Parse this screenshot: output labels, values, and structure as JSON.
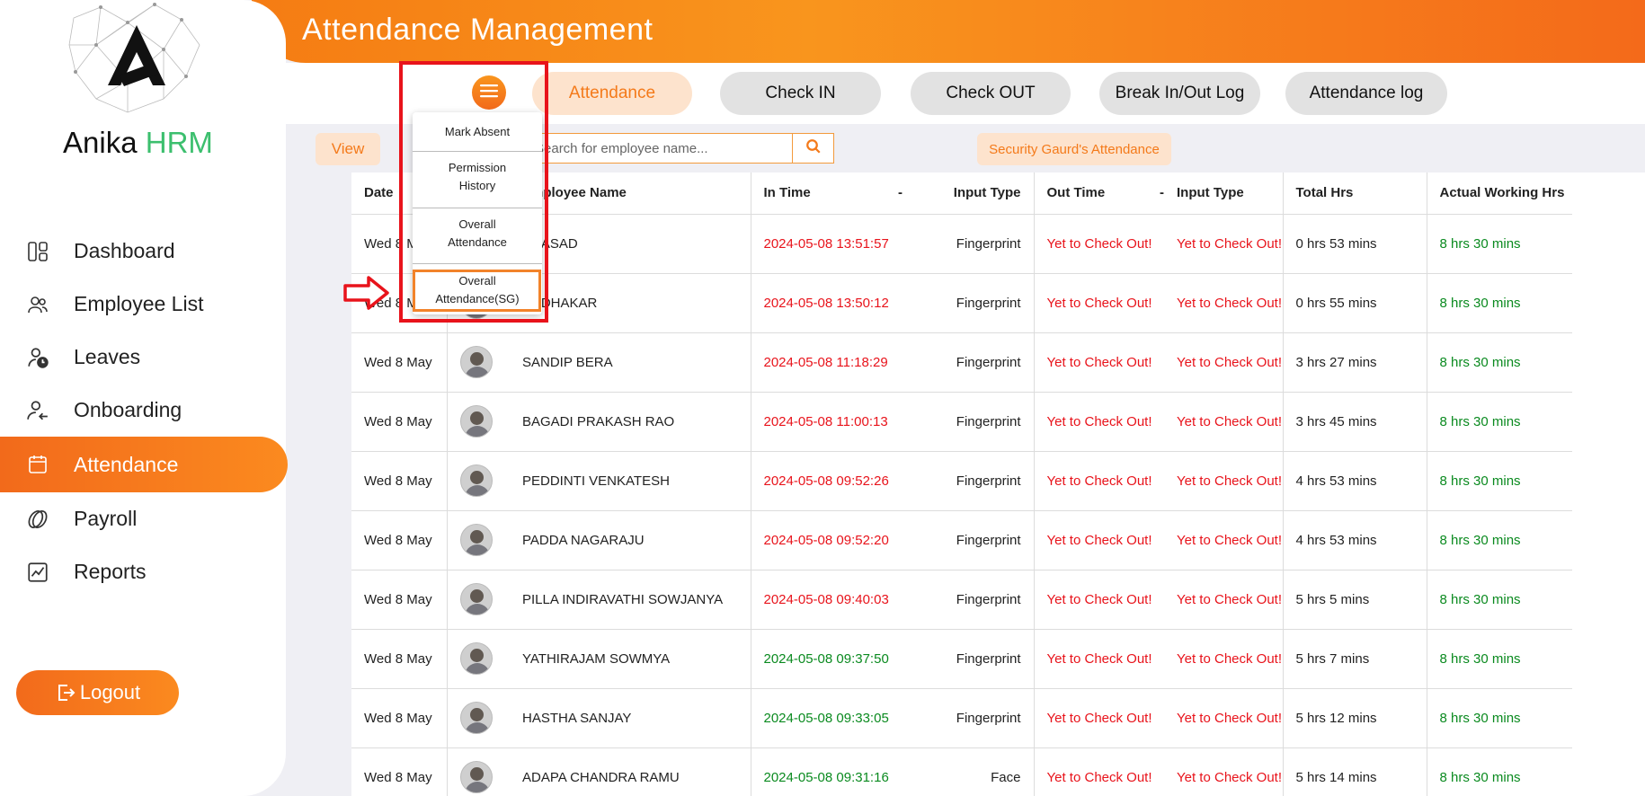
{
  "app": {
    "title": "Attendance Management",
    "brand_prefix": "Anika",
    "brand_suffix": "HRM",
    "accent_color": "#f47a1a"
  },
  "sidebar": {
    "items": [
      {
        "label": "Dashboard",
        "icon": "dashboard-icon",
        "active": false
      },
      {
        "label": "Employee List",
        "icon": "users-icon",
        "active": false
      },
      {
        "label": "Leaves",
        "icon": "user-clock-icon",
        "active": false
      },
      {
        "label": "Onboarding",
        "icon": "user-arrow-icon",
        "active": false
      },
      {
        "label": "Attendance",
        "icon": "calendar-icon",
        "active": true
      },
      {
        "label": "Payroll",
        "icon": "payroll-icon",
        "active": false
      },
      {
        "label": "Reports",
        "icon": "report-chart-icon",
        "active": false
      }
    ],
    "logout_label": "Logout"
  },
  "tabs": [
    {
      "label": "Attendance",
      "active": true
    },
    {
      "label": "Check IN",
      "active": false
    },
    {
      "label": "Check OUT",
      "active": false
    },
    {
      "label": "Break In/Out Log",
      "active": false
    },
    {
      "label": "Attendance log",
      "active": false
    }
  ],
  "toolbar": {
    "view_label": "View",
    "search_placeholder": "Search for employee name...",
    "sg_label": "Security Gaurd's Attendance"
  },
  "dropdown": {
    "items": [
      "Mark Absent",
      "Permission History",
      "Overall Attendance",
      "Overall Attendance(SG)"
    ],
    "highlighted": "Overall Attendance(SG)"
  },
  "table": {
    "headers": [
      "Date",
      "Employee Name",
      "In Time",
      "-",
      "Input Type",
      "Out Time",
      "-",
      "Input Type",
      "Total Hrs",
      "Actual Working Hrs"
    ],
    "rows": [
      {
        "date": "Wed 8 May",
        "name": "PRASAD",
        "in_time": "2024-05-08 13:51:57",
        "in_late": true,
        "in_type": "Fingerprint",
        "out_time": "Yet to Check Out!",
        "out_type": "Yet to Check Out!",
        "total": "0 hrs 53 mins",
        "actual": "8 hrs 30 mins"
      },
      {
        "date": "Wed 8 May",
        "name": "SUDHAKAR",
        "in_time": "2024-05-08 13:50:12",
        "in_late": true,
        "in_type": "Fingerprint",
        "out_time": "Yet to Check Out!",
        "out_type": "Yet to Check Out!",
        "total": "0 hrs 55 mins",
        "actual": "8 hrs 30 mins"
      },
      {
        "date": "Wed 8 May",
        "name": "SANDIP BERA",
        "in_time": "2024-05-08 11:18:29",
        "in_late": true,
        "in_type": "Fingerprint",
        "out_time": "Yet to Check Out!",
        "out_type": "Yet to Check Out!",
        "total": "3 hrs 27 mins",
        "actual": "8 hrs 30 mins"
      },
      {
        "date": "Wed 8 May",
        "name": "BAGADI PRAKASH RAO",
        "in_time": "2024-05-08 11:00:13",
        "in_late": true,
        "in_type": "Fingerprint",
        "out_time": "Yet to Check Out!",
        "out_type": "Yet to Check Out!",
        "total": "3 hrs 45 mins",
        "actual": "8 hrs 30 mins"
      },
      {
        "date": "Wed 8 May",
        "name": "PEDDINTI VENKATESH",
        "in_time": "2024-05-08 09:52:26",
        "in_late": true,
        "in_type": "Fingerprint",
        "out_time": "Yet to Check Out!",
        "out_type": "Yet to Check Out!",
        "total": "4 hrs 53 mins",
        "actual": "8 hrs 30 mins"
      },
      {
        "date": "Wed 8 May",
        "name": "PADDA NAGARAJU",
        "in_time": "2024-05-08 09:52:20",
        "in_late": true,
        "in_type": "Fingerprint",
        "out_time": "Yet to Check Out!",
        "out_type": "Yet to Check Out!",
        "total": "4 hrs 53 mins",
        "actual": "8 hrs 30 mins"
      },
      {
        "date": "Wed 8 May",
        "name": "PILLA INDIRAVATHI SOWJANYA",
        "in_time": "2024-05-08 09:40:03",
        "in_late": true,
        "in_type": "Fingerprint",
        "out_time": "Yet to Check Out!",
        "out_type": "Yet to Check Out!",
        "total": "5 hrs 5 mins",
        "actual": "8 hrs 30 mins"
      },
      {
        "date": "Wed 8 May",
        "name": "YATHIRAJAM SOWMYA",
        "in_time": "2024-05-08 09:37:50",
        "in_late": false,
        "in_type": "Fingerprint",
        "out_time": "Yet to Check Out!",
        "out_type": "Yet to Check Out!",
        "total": "5 hrs 7 mins",
        "actual": "8 hrs 30 mins"
      },
      {
        "date": "Wed 8 May",
        "name": "HASTHA SANJAY",
        "in_time": "2024-05-08 09:33:05",
        "in_late": false,
        "in_type": "Fingerprint",
        "out_time": "Yet to Check Out!",
        "out_type": "Yet to Check Out!",
        "total": "5 hrs 12 mins",
        "actual": "8 hrs 30 mins"
      },
      {
        "date": "Wed 8 May",
        "name": "ADAPA CHANDRA RAMU",
        "in_time": "2024-05-08 09:31:16",
        "in_late": false,
        "in_type": "Face",
        "out_time": "Yet to Check Out!",
        "out_type": "Yet to Check Out!",
        "total": "5 hrs 14 mins",
        "actual": "8 hrs 30 mins"
      }
    ]
  }
}
